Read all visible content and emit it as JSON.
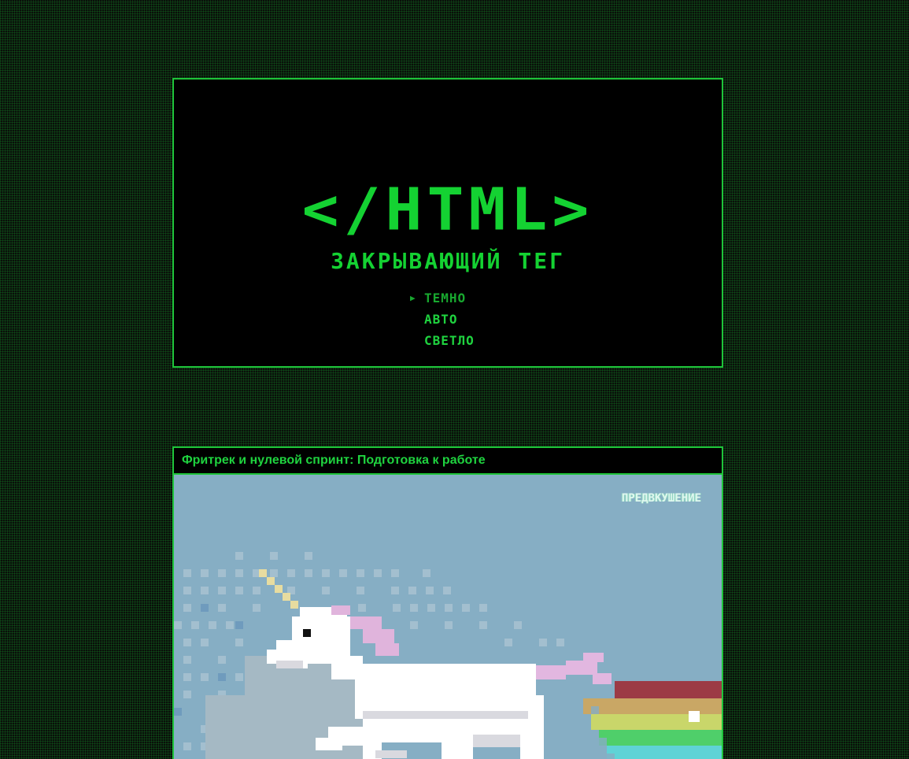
{
  "header": {
    "logo_text": "</HTML>",
    "subtitle": "ЗАКРЫВАЮЩИЙ ТЕГ",
    "theme_options": [
      {
        "label": "ТЕМНО",
        "active": true
      },
      {
        "label": "АВТО",
        "active": false
      },
      {
        "label": "СВЕТЛО",
        "active": false
      }
    ],
    "active_marker": "▶"
  },
  "article": {
    "title": "Фритрек и нулевой спринт: Подготовка к работе",
    "badge": "ПРЕДВКУШЕНИЕ",
    "image_subject": "pixel-unicorn-rainbow"
  },
  "colors": {
    "accent": "#1fd33f",
    "background": "#000000",
    "image_sky": "#86aec4"
  }
}
